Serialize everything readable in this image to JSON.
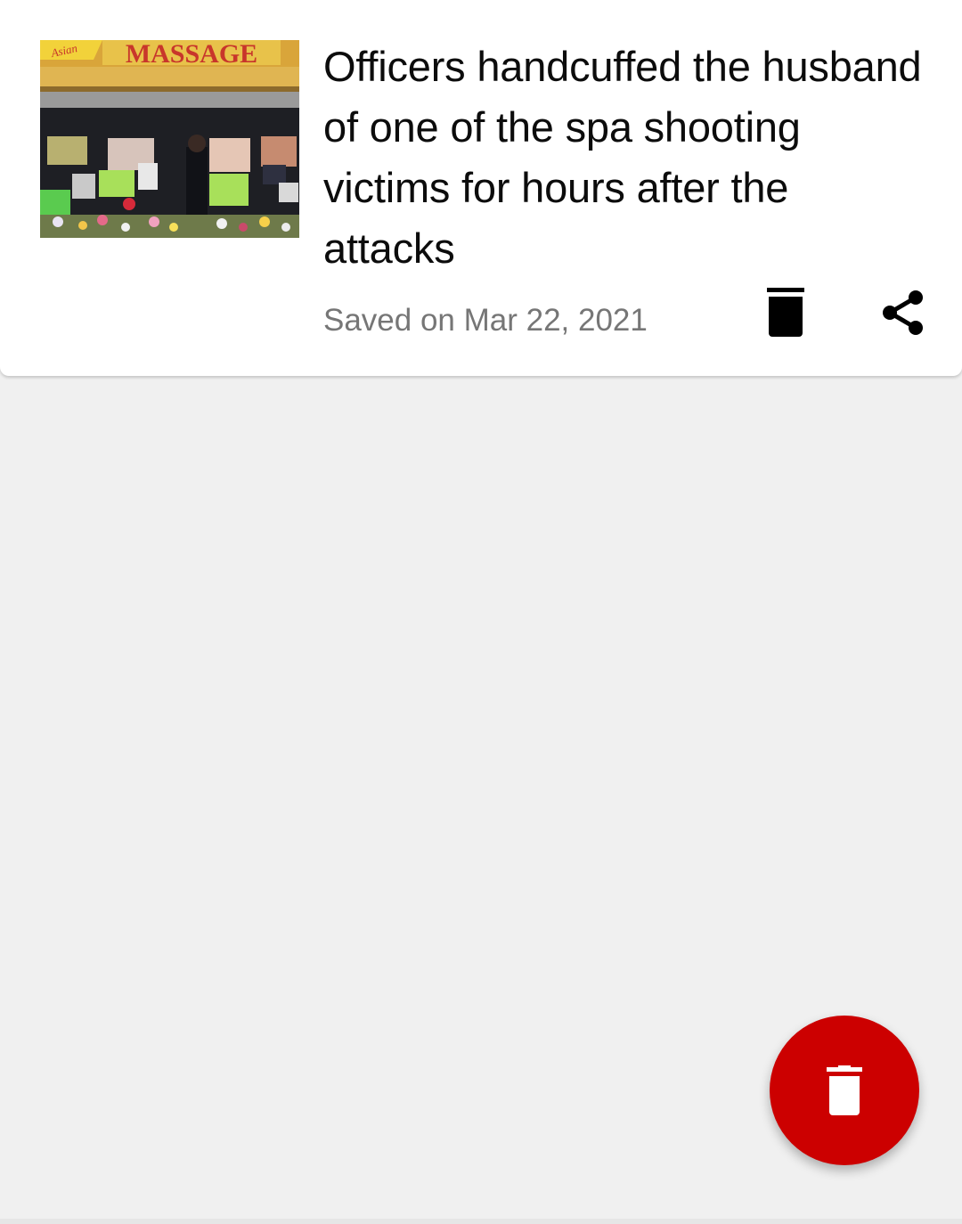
{
  "saved_item": {
    "headline": "Officers handcuffed the husband of one of the spa shooting victims for hours after the attacks",
    "saved_text": "Saved on Mar 22, 2021",
    "thumbnail_sign_text": "MASSAGE",
    "thumbnail_sign_badge": "Asian",
    "delete_icon": "trash-icon",
    "share_icon": "share-icon"
  },
  "fab": {
    "icon": "trash-icon",
    "color": "#cc0000"
  },
  "colors": {
    "background": "#f0f0f0",
    "card": "#ffffff",
    "headline": "#0c0c0c",
    "meta": "#767676"
  }
}
